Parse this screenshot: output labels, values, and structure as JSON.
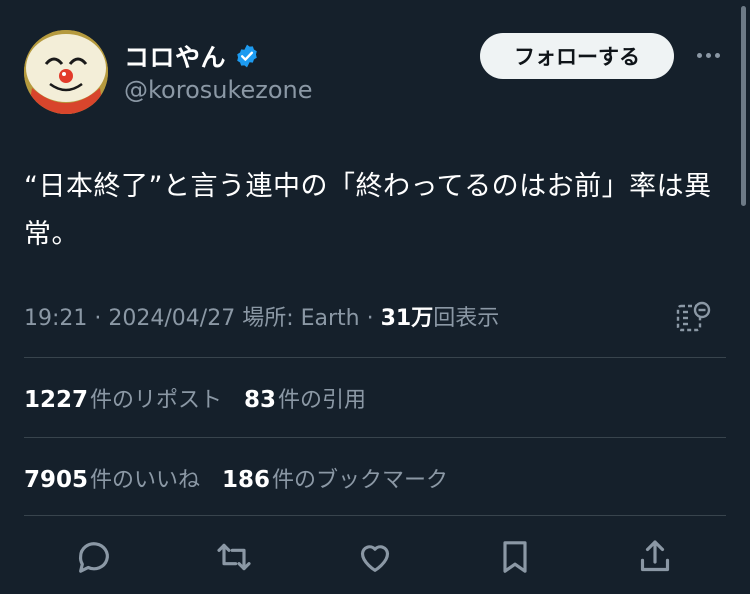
{
  "user": {
    "display_name": "コロやん",
    "handle": "@korosukezone",
    "verified_icon": "verified-badge-icon"
  },
  "follow_button": "フォローする",
  "tweet": {
    "text": "“日本終了”と言う連中の「終わってるのはお前」率は異常。"
  },
  "meta": {
    "time": "19:21",
    "sep1": " · ",
    "date": "2024/04/27",
    "location": " 場所: Earth",
    "sep2": " · ",
    "views_count": "31万",
    "views_label": "回表示"
  },
  "stats": {
    "reposts_count": "1227",
    "reposts_label": "件のリポスト",
    "quotes_count": "83",
    "quotes_label": "件の引用",
    "likes_count": "7905",
    "likes_label": "件のいいね",
    "bookmarks_count": "186",
    "bookmarks_label": "件のブックマーク"
  },
  "actions": [
    "reply-icon",
    "retweet-icon",
    "like-icon",
    "bookmark-icon",
    "share-icon"
  ],
  "colors": {
    "background": "#15202b",
    "text": "#ffffff",
    "secondary_text": "#8b98a5",
    "divider": "#38444d",
    "verified": "#1d9bf0",
    "follow_bg": "#eff3f4"
  }
}
